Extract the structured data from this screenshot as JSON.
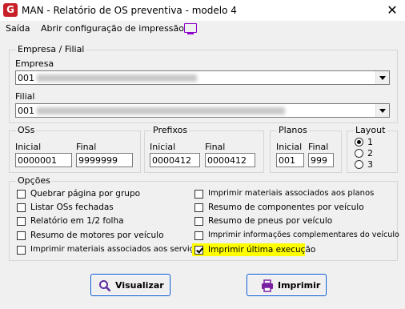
{
  "window": {
    "title": "MAN - Relatório de OS preventiva -  modelo 4",
    "icon": "G",
    "close": "✕"
  },
  "menu": {
    "items": [
      "Saída",
      "Abrir configuração de impressão"
    ]
  },
  "empresa_filial": {
    "legend": "Empresa / Filial",
    "empresa": {
      "label": "Empresa",
      "value": "001"
    },
    "filial": {
      "label": "Filial",
      "value": "001"
    }
  },
  "oss": {
    "legend": "OSs",
    "inicial_label": "Inicial",
    "final_label": "Final",
    "inicial": "0000001",
    "final": "9999999"
  },
  "prefixos": {
    "legend": "Prefixos",
    "inicial_label": "Inicial",
    "final_label": "Final",
    "inicial": "0000412",
    "final": "0000412"
  },
  "planos": {
    "legend": "Planos",
    "inicial_label": "Inicial",
    "final_label": "Final",
    "inicial": "001",
    "final": "999"
  },
  "layout": {
    "legend": "Layout",
    "options": [
      "1",
      "2",
      "3"
    ],
    "selected": "1"
  },
  "opcoes": {
    "legend": "Opções",
    "left": [
      {
        "label": "Quebrar página por grupo",
        "checked": false
      },
      {
        "label": "Listar OSs fechadas",
        "checked": false
      },
      {
        "label": "Relatório em 1/2 folha",
        "checked": false
      },
      {
        "label": "Resumo de motores por veículo",
        "checked": false
      },
      {
        "label": "Imprimir materiais associados aos serviços",
        "checked": false
      }
    ],
    "right": [
      {
        "label": "Imprimir materiais associados aos planos",
        "checked": false
      },
      {
        "label": "Resumo de componentes por veículo",
        "checked": false
      },
      {
        "label": "Resumo de pneus por veículo",
        "checked": false
      },
      {
        "label": "Imprimir informações complementares do veículo",
        "checked": false
      },
      {
        "label": "Imprimir última execução",
        "checked": true
      }
    ]
  },
  "buttons": {
    "visualizar": "Visualizar",
    "imprimir": "Imprimir"
  },
  "colors": {
    "highlight": "#ffff00",
    "app_icon": "#c72028",
    "print_icon": "#8b00c9",
    "button_border": "#0052cc"
  }
}
